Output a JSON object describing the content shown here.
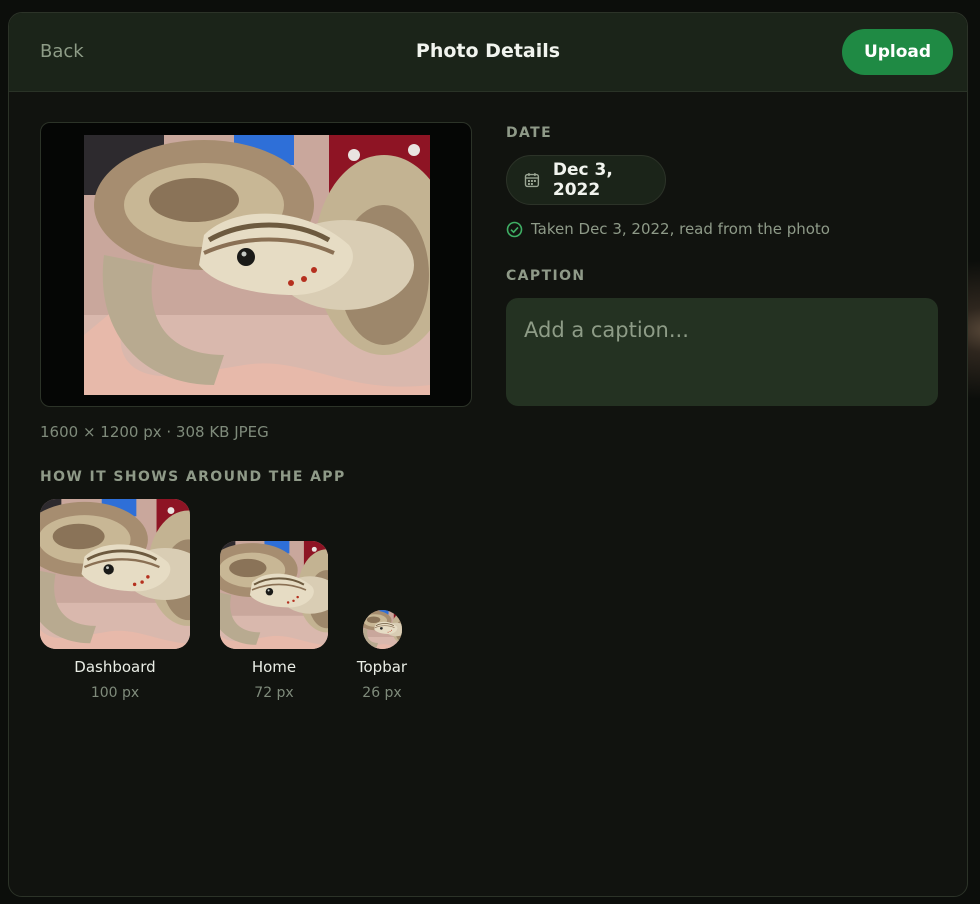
{
  "header": {
    "back_label": "Back",
    "title": "Photo Details",
    "upload_label": "Upload"
  },
  "photo": {
    "meta": "1600 × 1200 px · 308 KB JPEG"
  },
  "date": {
    "section_label": "DATE",
    "value": "Dec 3, 2022",
    "note": "Taken Dec 3, 2022, read from the photo",
    "icon": "calendar-icon",
    "note_icon": "check-circle-icon"
  },
  "caption": {
    "section_label": "CAPTION",
    "placeholder": "Add a caption..."
  },
  "previews": {
    "section_label": "HOW IT SHOWS AROUND THE APP",
    "items": [
      {
        "name": "Dashboard",
        "size": "100 px"
      },
      {
        "name": "Home",
        "size": "72 px"
      },
      {
        "name": "Topbar",
        "size": "26 px"
      }
    ]
  },
  "colors": {
    "accent": "#1f8a44",
    "panel": "#11130f",
    "header": "#1b2419",
    "input": "#243222"
  }
}
